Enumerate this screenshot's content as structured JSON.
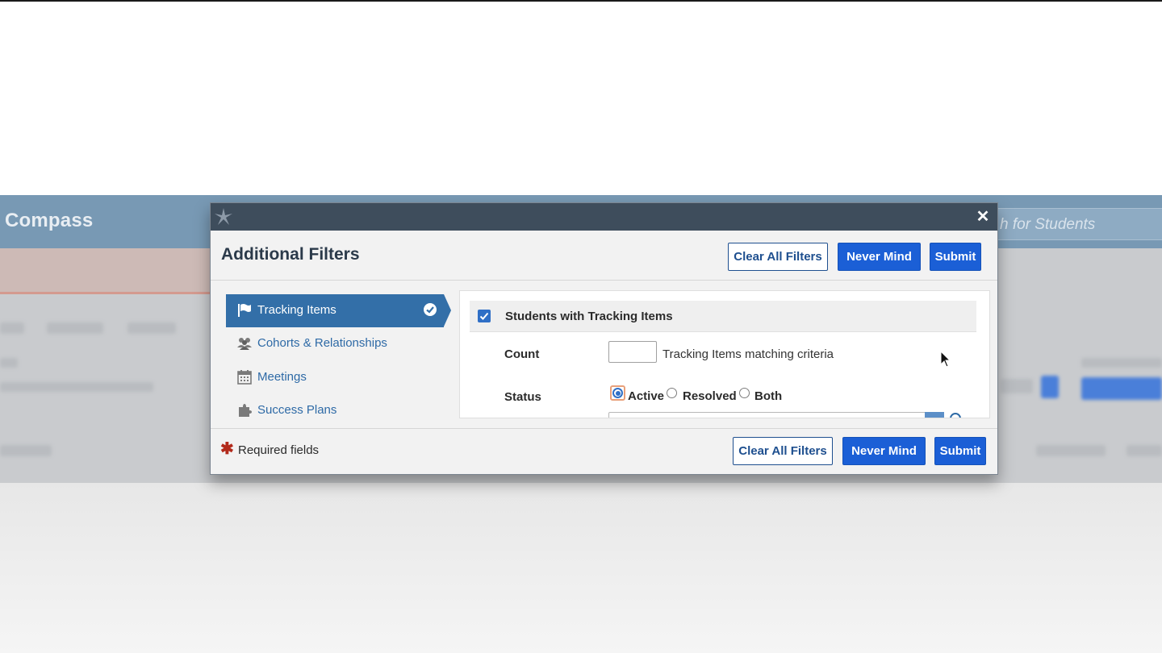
{
  "background_app": {
    "brand": "Compass",
    "search_placeholder": "h for Students"
  },
  "modal": {
    "title": "Additional Filters",
    "buttons": {
      "clear_all": "Clear All Filters",
      "never_mind": "Never Mind",
      "submit": "Submit"
    },
    "nav": [
      {
        "label": "Tracking Items",
        "icon": "flag-icon",
        "active": true
      },
      {
        "label": "Cohorts & Relationships",
        "icon": "users-icon",
        "active": false
      },
      {
        "label": "Meetings",
        "icon": "calendar-icon",
        "active": false
      },
      {
        "label": "Success Plans",
        "icon": "puzzle-icon",
        "active": false
      }
    ],
    "panel": {
      "section_title": "Students with Tracking Items",
      "section_checked": true,
      "count_label": "Count",
      "count_value": "",
      "count_help": "Tracking Items matching criteria",
      "status_label": "Status",
      "status_options": [
        "Active",
        "Resolved",
        "Both"
      ],
      "status_selected": "Active"
    },
    "footer": {
      "required_mark": "✱",
      "required_text": "Required fields"
    }
  },
  "colors": {
    "titlebar": "#3e4d5c",
    "primary": "#1b5fd6",
    "nav_active": "#336fa8",
    "link": "#2e6aa6",
    "required": "#b22a1b"
  }
}
